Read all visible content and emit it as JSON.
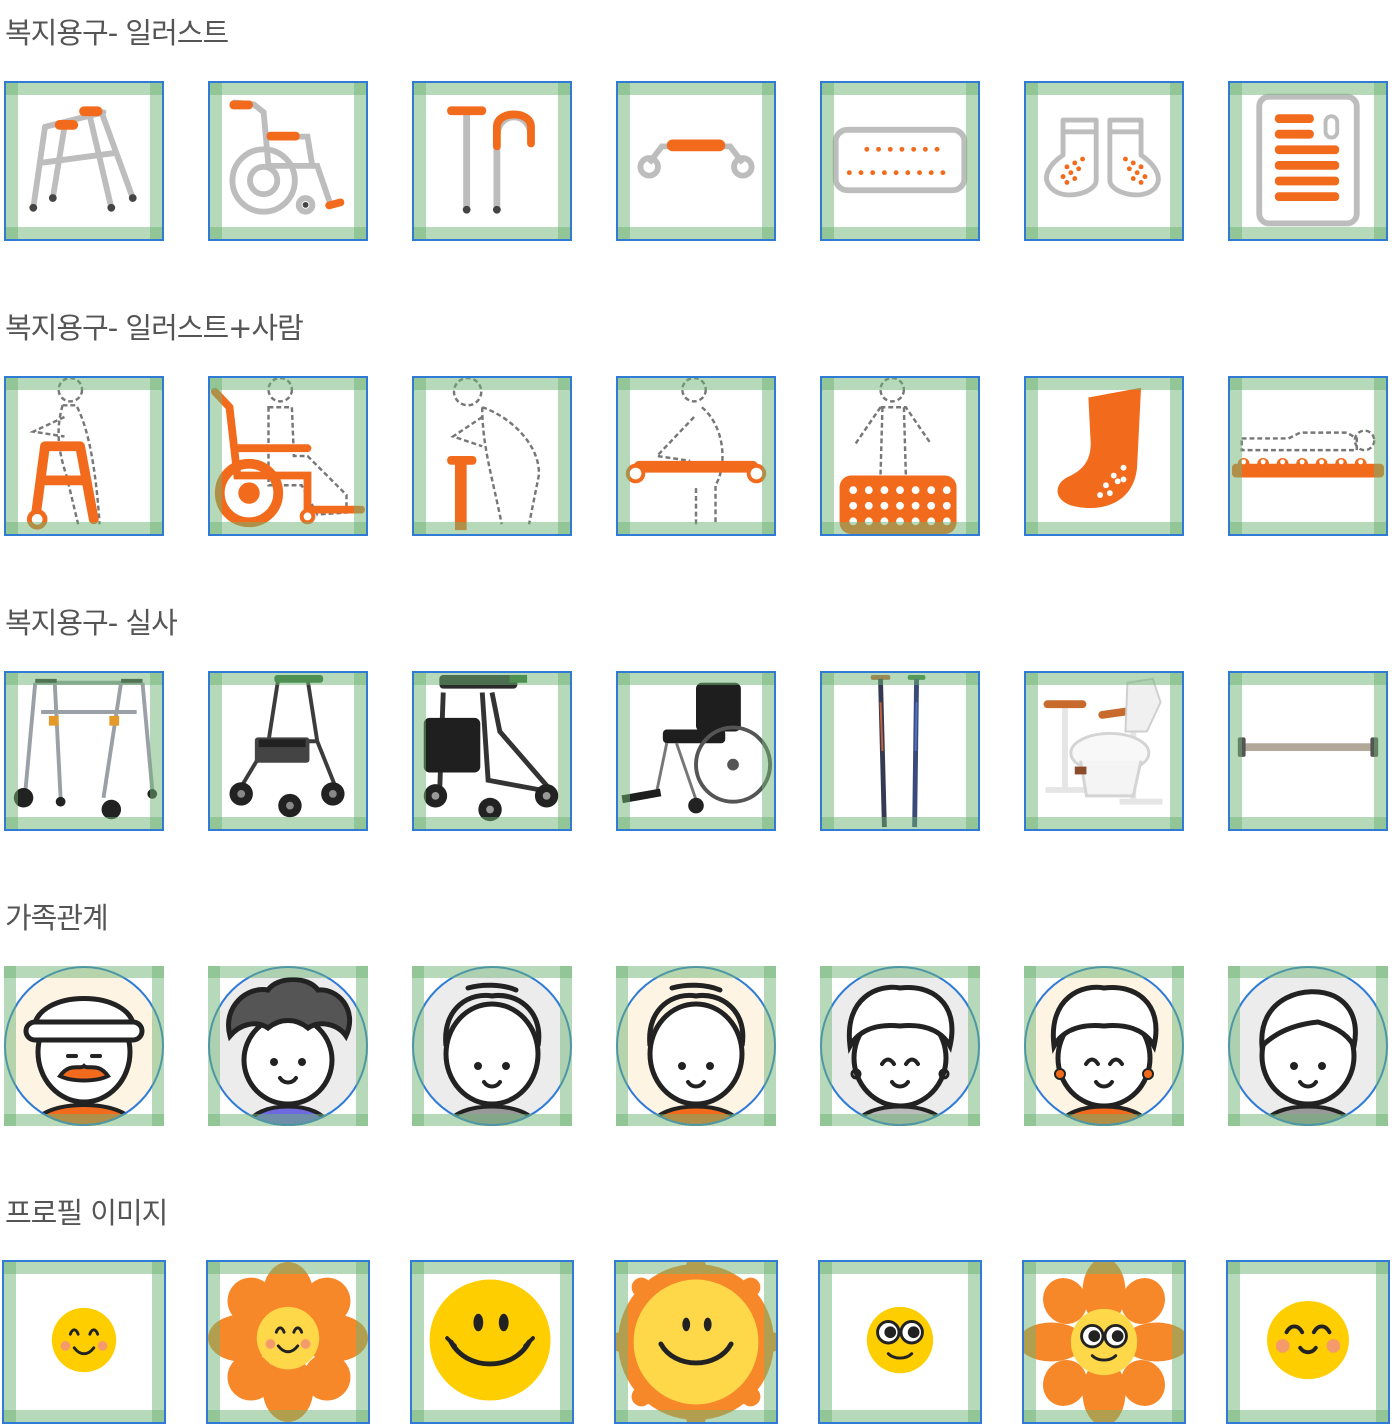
{
  "sections": [
    {
      "title": "복지용구- 일러스트"
    },
    {
      "title": "복지용구- 일러스트+사람"
    },
    {
      "title": "복지용구- 실사"
    },
    {
      "title": "가족관계"
    },
    {
      "title": "프로필 이미지"
    }
  ],
  "colors": {
    "accent": "#f26b1d",
    "outline": "#bdbdbd",
    "guide_border": "#2f7bd6",
    "guide_fill": "#8cc590",
    "smiley": "#ffce00"
  }
}
